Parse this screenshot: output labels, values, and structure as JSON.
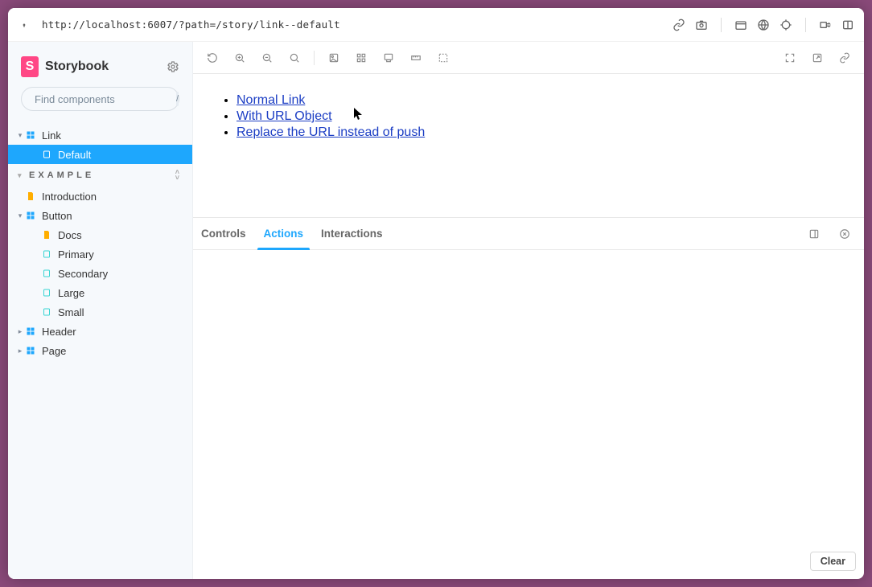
{
  "chrome": {
    "url": "http://localhost:6007/?path=/story/link--default"
  },
  "brand": {
    "mark": "S",
    "name": "Storybook"
  },
  "search": {
    "placeholder": "Find components",
    "shortcut": "/"
  },
  "tree": {
    "link": {
      "label": "Link",
      "default": "Default"
    },
    "group": "EXAMPLE",
    "introduction": "Introduction",
    "button": {
      "label": "Button",
      "docs": "Docs",
      "primary": "Primary",
      "secondary": "Secondary",
      "large": "Large",
      "small": "Small"
    },
    "header": "Header",
    "page": "Page"
  },
  "preview": {
    "links": {
      "normal": "Normal Link",
      "url_object": "With URL Object",
      "replace": "Replace the URL instead of push"
    }
  },
  "addons": {
    "controls": "Controls",
    "actions": "Actions",
    "interactions": "Interactions",
    "clear": "Clear"
  }
}
